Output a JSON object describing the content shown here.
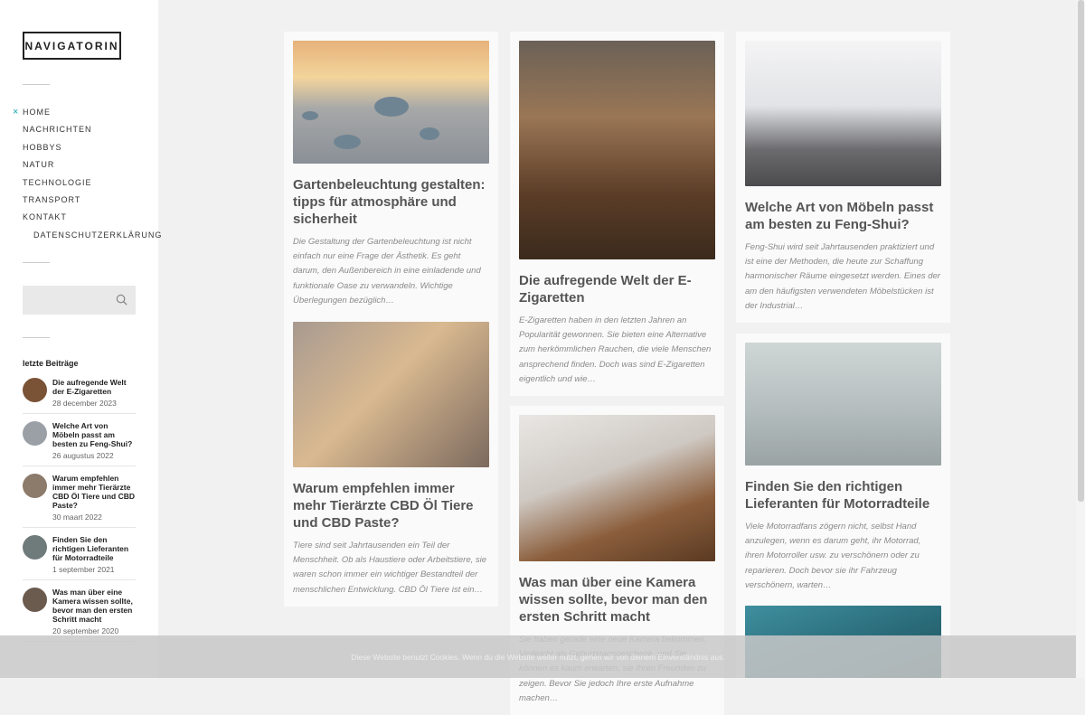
{
  "site": {
    "logo": "NAVIGATORIN"
  },
  "nav": [
    {
      "label": "Home",
      "active": true
    },
    {
      "label": "Nachrichten"
    },
    {
      "label": "Hobbys"
    },
    {
      "label": "Natur"
    },
    {
      "label": "Technologie"
    },
    {
      "label": "Transport"
    },
    {
      "label": "Kontakt"
    },
    {
      "label": "Datenschutzerklärung",
      "sub": true
    }
  ],
  "search": {
    "placeholder": "",
    "icon": "search-icon"
  },
  "recent": {
    "title": "letzte Beiträge",
    "items": [
      {
        "title": "Die aufregende Welt der E-Zigaretten",
        "date": "28 december 2023",
        "thumb_color": "#7a5236"
      },
      {
        "title": "Welche Art von Möbeln passt am besten zu Feng-Shui?",
        "date": "26 augustus 2022",
        "thumb_color": "#9aa0a6"
      },
      {
        "title": "Warum empfehlen immer mehr Tierärzte CBD Öl Tiere und CBD Paste?",
        "date": "30 maart 2022",
        "thumb_color": "#8c7a6a"
      },
      {
        "title": "Finden Sie den richtigen Lieferanten für Motorradteile",
        "date": "1 september 2021",
        "thumb_color": "#6f7a7a"
      },
      {
        "title": "Was man über eine Kamera wissen sollte, bevor man den ersten Schritt macht",
        "date": "20 september 2020",
        "thumb_color": "#6b5a4e"
      }
    ]
  },
  "posts": [
    {
      "title": "Gartenbeleuchtung gestalten: tipps für atmosphäre und sicherheit",
      "excerpt": "Die Gestaltung der Gartenbeleuchtung ist nicht einfach nur eine Frage der Ästhetik. Es geht darum, den Außenbereich in eine einladende und funktionale Oase zu verwandeln. Wichtige Überlegungen bezüglich…"
    },
    {
      "title": "Die aufregende Welt der E-Zigaretten",
      "excerpt": "E-Zigaretten haben in den letzten Jahren an Popularität gewonnen. Sie bieten eine Alternative zum herkömmlichen Rauchen, die viele Menschen ansprechend finden. Doch was sind E-Zigaretten eigentlich und wie…"
    },
    {
      "title": "Welche Art von Möbeln passt am besten zu Feng-Shui?",
      "excerpt": "Feng-Shui wird seit Jahrtausenden praktiziert und ist eine der Methoden, die heute zur Schaffung harmonischer Räume eingesetzt werden. Eines der am den häufigsten verwendeten Möbelstücken ist der Industrial…"
    },
    {
      "title": "Warum empfehlen immer mehr Tierärzte CBD Öl Tiere und CBD Paste?",
      "excerpt": "Tiere sind seit Jahrtausenden ein Teil der Menschheit. Ob als Haustiere oder Arbeitstiere, sie waren schon immer ein wichtiger Bestandteil der menschlichen Entwicklung. CBD Öl Tiere ist ein…"
    },
    {
      "title": "Was man über eine Kamera wissen sollte, bevor man den ersten Schritt macht",
      "excerpt": "Sie haben gerade eine neue Kamera bekommen. Vielleicht als Geburtstagsgeschenk, und Sie können es kaum erwarten, sie Ihren Freunden zu zeigen. Bevor Sie jedoch Ihre erste Aufnahme machen…"
    },
    {
      "title": "Finden Sie den richtigen Lieferanten für Motorradteile",
      "excerpt": "Viele Motorradfans zögern nicht, selbst Hand anzulegen, wenn es darum geht, ihr Motorrad, ihren Motorroller usw. zu verschönern oder zu reparieren. Doch bevor sie ihr Fahrzeug verschönern, warten…"
    }
  ],
  "cookie": {
    "text": "Diese Website benutzt Cookies. Wenn du die Website weiter nutzt, gehen wir von deinem Einverständnis aus."
  }
}
